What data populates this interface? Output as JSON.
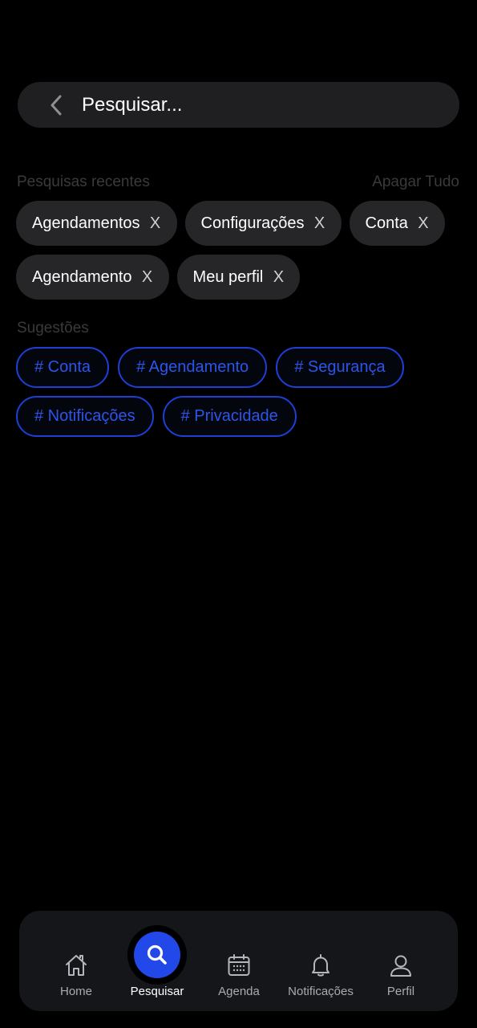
{
  "search": {
    "placeholder": "Pesquisar..."
  },
  "recent": {
    "title": "Pesquisas recentes",
    "clear_all": "Apagar Tudo",
    "remove_symbol": "X",
    "items": [
      {
        "label": "Agendamentos"
      },
      {
        "label": "Configurações"
      },
      {
        "label": "Conta"
      },
      {
        "label": "Agendamento"
      },
      {
        "label": "Meu perfil"
      }
    ]
  },
  "suggestions": {
    "title": "Sugestões",
    "tags": [
      {
        "label": "# Conta"
      },
      {
        "label": "# Agendamento"
      },
      {
        "label": "# Segurança"
      },
      {
        "label": "# Notificações"
      },
      {
        "label": "# Privacidade"
      }
    ]
  },
  "bottom_nav": {
    "active": "Pesquisar",
    "items": [
      {
        "label": "Home",
        "icon": "home-icon"
      },
      {
        "label": "Pesquisar",
        "icon": "search-icon"
      },
      {
        "label": "Agenda",
        "icon": "calendar-icon"
      },
      {
        "label": "Notificações",
        "icon": "bell-icon"
      },
      {
        "label": "Perfil",
        "icon": "user-icon"
      }
    ]
  },
  "colors": {
    "background": "#000000",
    "accent": "#2348ea",
    "chip_background": "#262628",
    "tag_text": "#2c55ea"
  }
}
